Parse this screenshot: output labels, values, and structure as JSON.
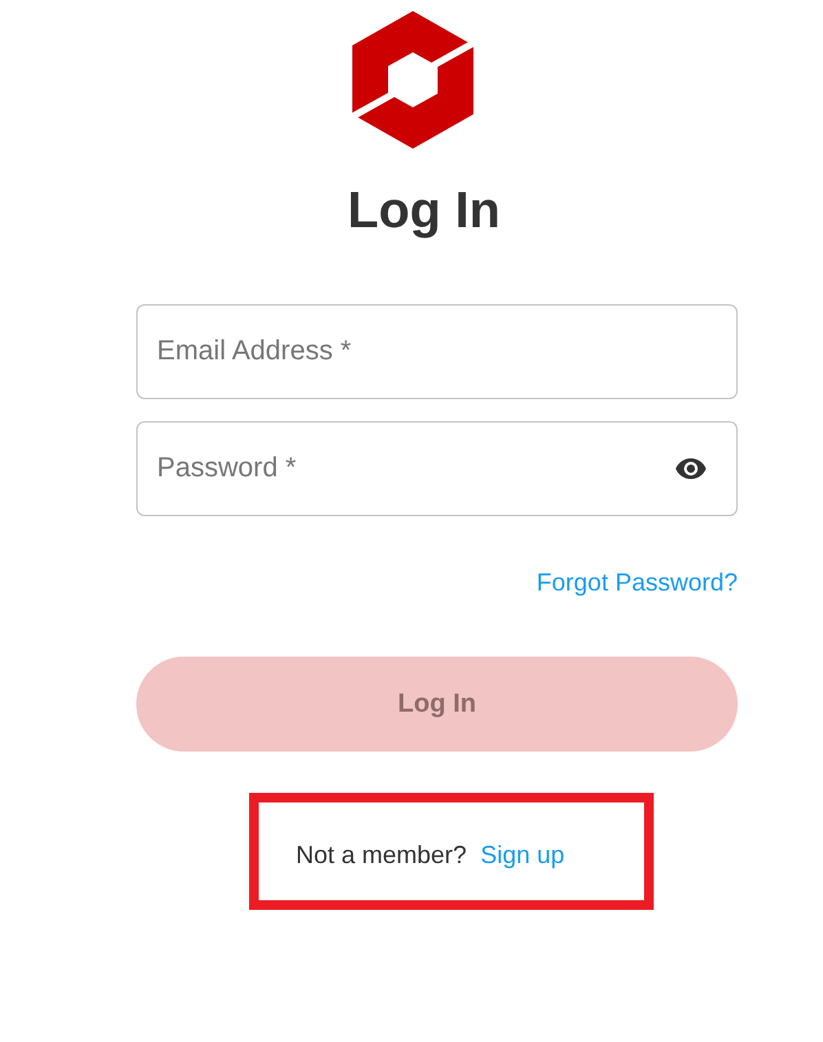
{
  "title": "Log In",
  "fields": [
    {
      "kind": "email",
      "placeholder": "Email Address *"
    },
    {
      "kind": "password",
      "placeholder": "Password *"
    }
  ],
  "forgot_link": "Forgot Password?",
  "login_button": {
    "label": "Log In",
    "disabled": true
  },
  "signup_prompt": {
    "text": "Not a member?",
    "link": "Sign up",
    "highlighted": true
  }
}
